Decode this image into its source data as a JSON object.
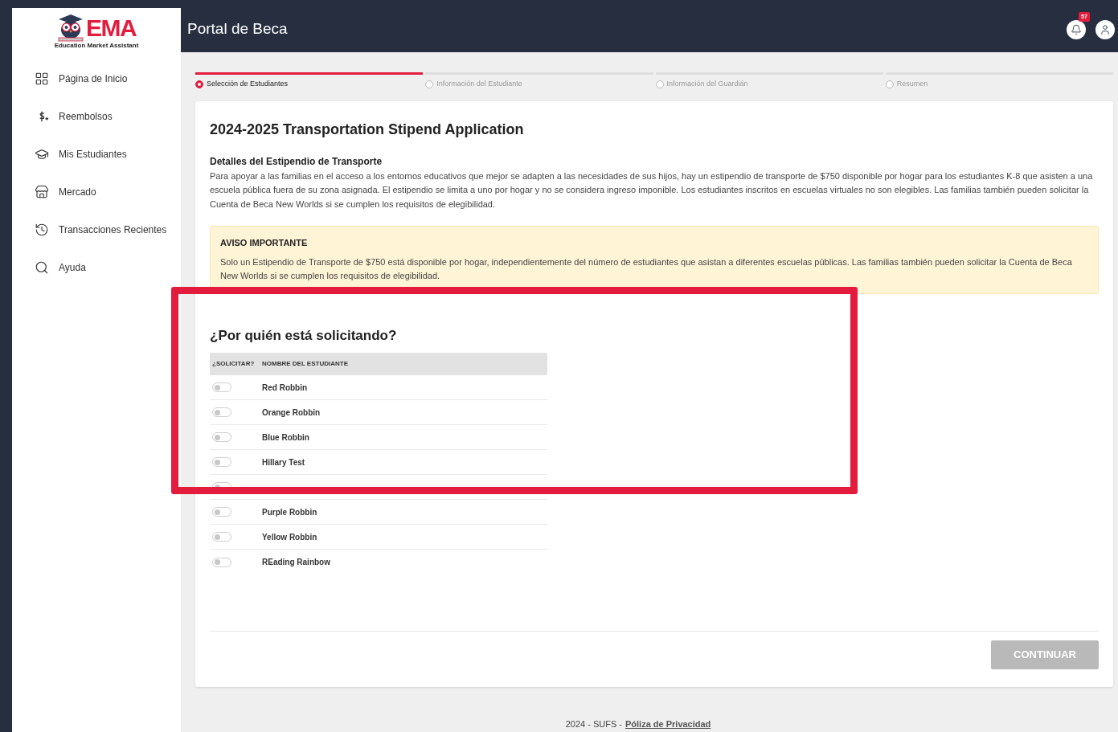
{
  "logo": {
    "mark": "EMA",
    "tagline": "Education Market Assistant"
  },
  "sidebar": {
    "items": [
      {
        "kind": "home",
        "label": "Página de Inicio"
      },
      {
        "kind": "reimburse",
        "label": "Reembolsos"
      },
      {
        "kind": "students",
        "label": "Mis Estudiantes"
      },
      {
        "kind": "market",
        "label": "Mercado"
      },
      {
        "kind": "history",
        "label": "Transacciones Recientes"
      },
      {
        "kind": "help",
        "label": "Ayuda"
      }
    ]
  },
  "header": {
    "title": "Portal de Beca",
    "notifications": "57"
  },
  "steps": [
    {
      "label": "Selección de Estudiantes",
      "selected": true
    },
    {
      "label": "Información del Estudiante",
      "selected": false
    },
    {
      "label": "Información del Guardián",
      "selected": false
    },
    {
      "label": "Resumen",
      "selected": false
    }
  ],
  "card": {
    "title": "2024-2025 Transportation Stipend Application",
    "details_heading": "Detalles del Estipendio de Transporte",
    "details_text": "Para apoyar a las familias en el acceso a los entornos educativos que mejor se adapten a las necesidades de sus hijos, hay un estipendio de transporte de $750 disponible por hogar para los estudiantes K-8 que asisten a una escuela pública fuera de su zona asignada. El estipendio se limita a uno por hogar y no se considera ingreso imponible. Los estudiantes inscritos en escuelas virtuales no son elegibles. Las familias también pueden solicitar la Cuenta de Beca New Worlds si se cumplen los requisitos de elegibilidad.",
    "notice_heading": "AVISO IMPORTANTE",
    "notice_text": "Solo un Estipendio de Transporte de $750 está disponible por hogar, independientemente del número de estudiantes que asistan a diferentes escuelas públicas. Las familias también pueden solicitar la Cuenta de Beca New Worlds si se cumplen los requisitos de elegibilidad.",
    "question": "¿Por quién está solicitando?",
    "table": {
      "columns": [
        "¿SOLICITAR?",
        "NOMBRE DEL ESTUDIANTE"
      ],
      "rows": [
        {
          "on": false,
          "name": "Red Robbin"
        },
        {
          "on": false,
          "name": "Orange Robbin"
        },
        {
          "on": false,
          "name": "Blue Robbin"
        },
        {
          "on": false,
          "name": "Hillary Test"
        },
        {
          "on": false
        },
        {
          "on": false,
          "name": "Purple Robbin"
        },
        {
          "on": false,
          "name": "Yellow Robbin"
        },
        {
          "on": false,
          "name": "REading Rainbow"
        }
      ]
    },
    "continue_button": {
      "label": "CONTINUAR",
      "disabled": true
    }
  },
  "footer": {
    "text": "2024 - SUFS - ",
    "link": "Póliza de Privacidad"
  },
  "annotation": {
    "kind": "highlight-frame"
  }
}
